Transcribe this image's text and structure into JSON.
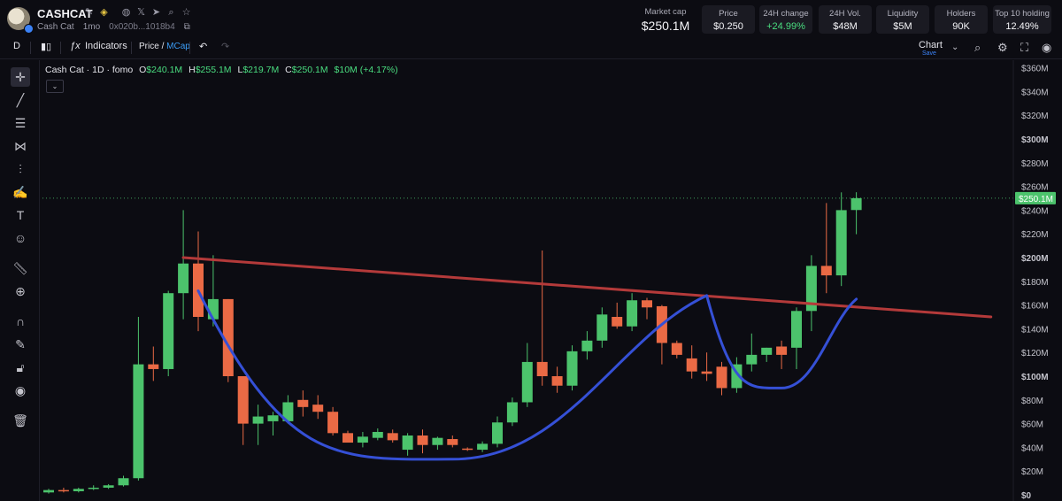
{
  "header": {
    "ticker": "CASHCAT",
    "name": "Cash Cat",
    "age": "1mo",
    "address": "0x020b...1018b4",
    "icons": [
      "pencil-icon",
      "coin-icon",
      "globe-icon",
      "x-icon",
      "telegram-icon",
      "search-icon",
      "star-icon"
    ],
    "market_cap": {
      "label": "Market cap",
      "value": "$250.1M"
    },
    "stats": [
      {
        "label": "Price",
        "value": "$0.250"
      },
      {
        "label": "24H change",
        "value": "+24.99%",
        "color": "#4ade80"
      },
      {
        "label": "24H Vol.",
        "value": "$48M"
      },
      {
        "label": "Liquidity",
        "value": "$5M"
      },
      {
        "label": "Holders",
        "value": "90K"
      },
      {
        "label": "Top 10 holding",
        "value": "12.49%"
      }
    ]
  },
  "toolbar": {
    "interval": "D",
    "indicators": "Indicators",
    "price": "Price",
    "slash": " / ",
    "mcap": "MCap",
    "chart": "Chart",
    "save": "Save"
  },
  "legend": {
    "symbol": "Cash Cat · 1D · fomo",
    "o": "$240.1M",
    "h": "$255.1M",
    "l": "$219.7M",
    "c": "$250.1M",
    "change": "$10M (+4.17%)"
  },
  "colors": {
    "up": "#4cc36c",
    "down": "#ea6a45",
    "trendline": "#b43a3a",
    "curve": "#3550d6",
    "last_price": "#4cc36c"
  },
  "chart_data": {
    "type": "candlestick",
    "y_unit": "$M",
    "ylim": [
      0,
      368
    ],
    "y_ticks": [
      "$360M",
      "$340M",
      "$320M",
      "$300M",
      "$280M",
      "$260M",
      "$240M",
      "$220M",
      "$200M",
      "$180M",
      "$160M",
      "$140M",
      "$120M",
      "$100M",
      "$80M",
      "$60M",
      "$40M",
      "$20M",
      "$0"
    ],
    "y_tick_values": [
      360,
      340,
      320,
      300,
      280,
      260,
      240,
      220,
      200,
      180,
      160,
      140,
      120,
      100,
      80,
      60,
      40,
      20,
      0
    ],
    "last_price_label": "$250.1M",
    "last_price": 250.1,
    "candles": [
      {
        "o": 2,
        "h": 5,
        "l": 1,
        "c": 4
      },
      {
        "o": 4,
        "h": 6,
        "l": 2,
        "c": 3
      },
      {
        "o": 3,
        "h": 6,
        "l": 2,
        "c": 5
      },
      {
        "o": 5,
        "h": 8,
        "l": 4,
        "c": 6
      },
      {
        "o": 6,
        "h": 9,
        "l": 5,
        "c": 8
      },
      {
        "o": 8,
        "h": 16,
        "l": 7,
        "c": 14
      },
      {
        "o": 14,
        "h": 150,
        "l": 12,
        "c": 110
      },
      {
        "o": 110,
        "h": 125,
        "l": 96,
        "c": 106
      },
      {
        "o": 106,
        "h": 172,
        "l": 100,
        "c": 170
      },
      {
        "o": 170,
        "h": 240,
        "l": 148,
        "c": 195
      },
      {
        "o": 195,
        "h": 222,
        "l": 138,
        "c": 150
      },
      {
        "o": 148,
        "h": 202,
        "l": 142,
        "c": 165
      },
      {
        "o": 165,
        "h": 165,
        "l": 95,
        "c": 100
      },
      {
        "o": 100,
        "h": 100,
        "l": 42,
        "c": 60
      },
      {
        "o": 60,
        "h": 76,
        "l": 42,
        "c": 66
      },
      {
        "o": 62,
        "h": 70,
        "l": 50,
        "c": 67
      },
      {
        "o": 62,
        "h": 84,
        "l": 60,
        "c": 78
      },
      {
        "o": 80,
        "h": 88,
        "l": 66,
        "c": 74
      },
      {
        "o": 76,
        "h": 84,
        "l": 64,
        "c": 70
      },
      {
        "o": 70,
        "h": 74,
        "l": 50,
        "c": 52
      },
      {
        "o": 52,
        "h": 54,
        "l": 44,
        "c": 44
      },
      {
        "o": 44,
        "h": 53,
        "l": 40,
        "c": 49
      },
      {
        "o": 48,
        "h": 56,
        "l": 46,
        "c": 53
      },
      {
        "o": 52,
        "h": 55,
        "l": 44,
        "c": 46
      },
      {
        "o": 38,
        "h": 52,
        "l": 33,
        "c": 50
      },
      {
        "o": 50,
        "h": 55,
        "l": 35,
        "c": 42
      },
      {
        "o": 42,
        "h": 49,
        "l": 38,
        "c": 48
      },
      {
        "o": 47,
        "h": 50,
        "l": 40,
        "c": 42
      },
      {
        "o": 39,
        "h": 40,
        "l": 37,
        "c": 38
      },
      {
        "o": 38,
        "h": 45,
        "l": 36,
        "c": 43
      },
      {
        "o": 43,
        "h": 66,
        "l": 40,
        "c": 61
      },
      {
        "o": 61,
        "h": 82,
        "l": 58,
        "c": 78
      },
      {
        "o": 78,
        "h": 128,
        "l": 74,
        "c": 112
      },
      {
        "o": 112,
        "h": 206,
        "l": 92,
        "c": 100
      },
      {
        "o": 100,
        "h": 108,
        "l": 86,
        "c": 92
      },
      {
        "o": 92,
        "h": 126,
        "l": 88,
        "c": 121
      },
      {
        "o": 121,
        "h": 138,
        "l": 114,
        "c": 130
      },
      {
        "o": 130,
        "h": 158,
        "l": 124,
        "c": 152
      },
      {
        "o": 150,
        "h": 162,
        "l": 140,
        "c": 142
      },
      {
        "o": 142,
        "h": 170,
        "l": 138,
        "c": 164
      },
      {
        "o": 164,
        "h": 166,
        "l": 148,
        "c": 158
      },
      {
        "o": 159,
        "h": 160,
        "l": 110,
        "c": 128
      },
      {
        "o": 128,
        "h": 130,
        "l": 115,
        "c": 118
      },
      {
        "o": 115,
        "h": 126,
        "l": 98,
        "c": 104
      },
      {
        "o": 104,
        "h": 120,
        "l": 96,
        "c": 102
      },
      {
        "o": 108,
        "h": 112,
        "l": 84,
        "c": 90
      },
      {
        "o": 90,
        "h": 116,
        "l": 86,
        "c": 110
      },
      {
        "o": 110,
        "h": 136,
        "l": 104,
        "c": 118
      },
      {
        "o": 118,
        "h": 124,
        "l": 112,
        "c": 124
      },
      {
        "o": 125,
        "h": 130,
        "l": 106,
        "c": 118
      },
      {
        "o": 124,
        "h": 158,
        "l": 106,
        "c": 155
      },
      {
        "o": 155,
        "h": 202,
        "l": 138,
        "c": 193
      },
      {
        "o": 193,
        "h": 246,
        "l": 170,
        "c": 185
      },
      {
        "o": 185,
        "h": 255,
        "l": 176,
        "c": 240
      },
      {
        "o": 240.1,
        "h": 255.1,
        "l": 219.7,
        "c": 250.1
      }
    ],
    "trendline": [
      {
        "candle": 9,
        "value": 200
      },
      {
        "candle": 63,
        "value": 150
      }
    ],
    "curves": [
      {
        "from_candle": 10,
        "to_candle": 44,
        "bottom_candle": 27,
        "start_value": 172,
        "bottom_value": 30,
        "end_value": 168
      },
      {
        "from_candle": 44,
        "to_candle": 54,
        "bottom_candle": 49,
        "start_value": 168,
        "bottom_value": 90,
        "end_value": 165
      }
    ]
  }
}
